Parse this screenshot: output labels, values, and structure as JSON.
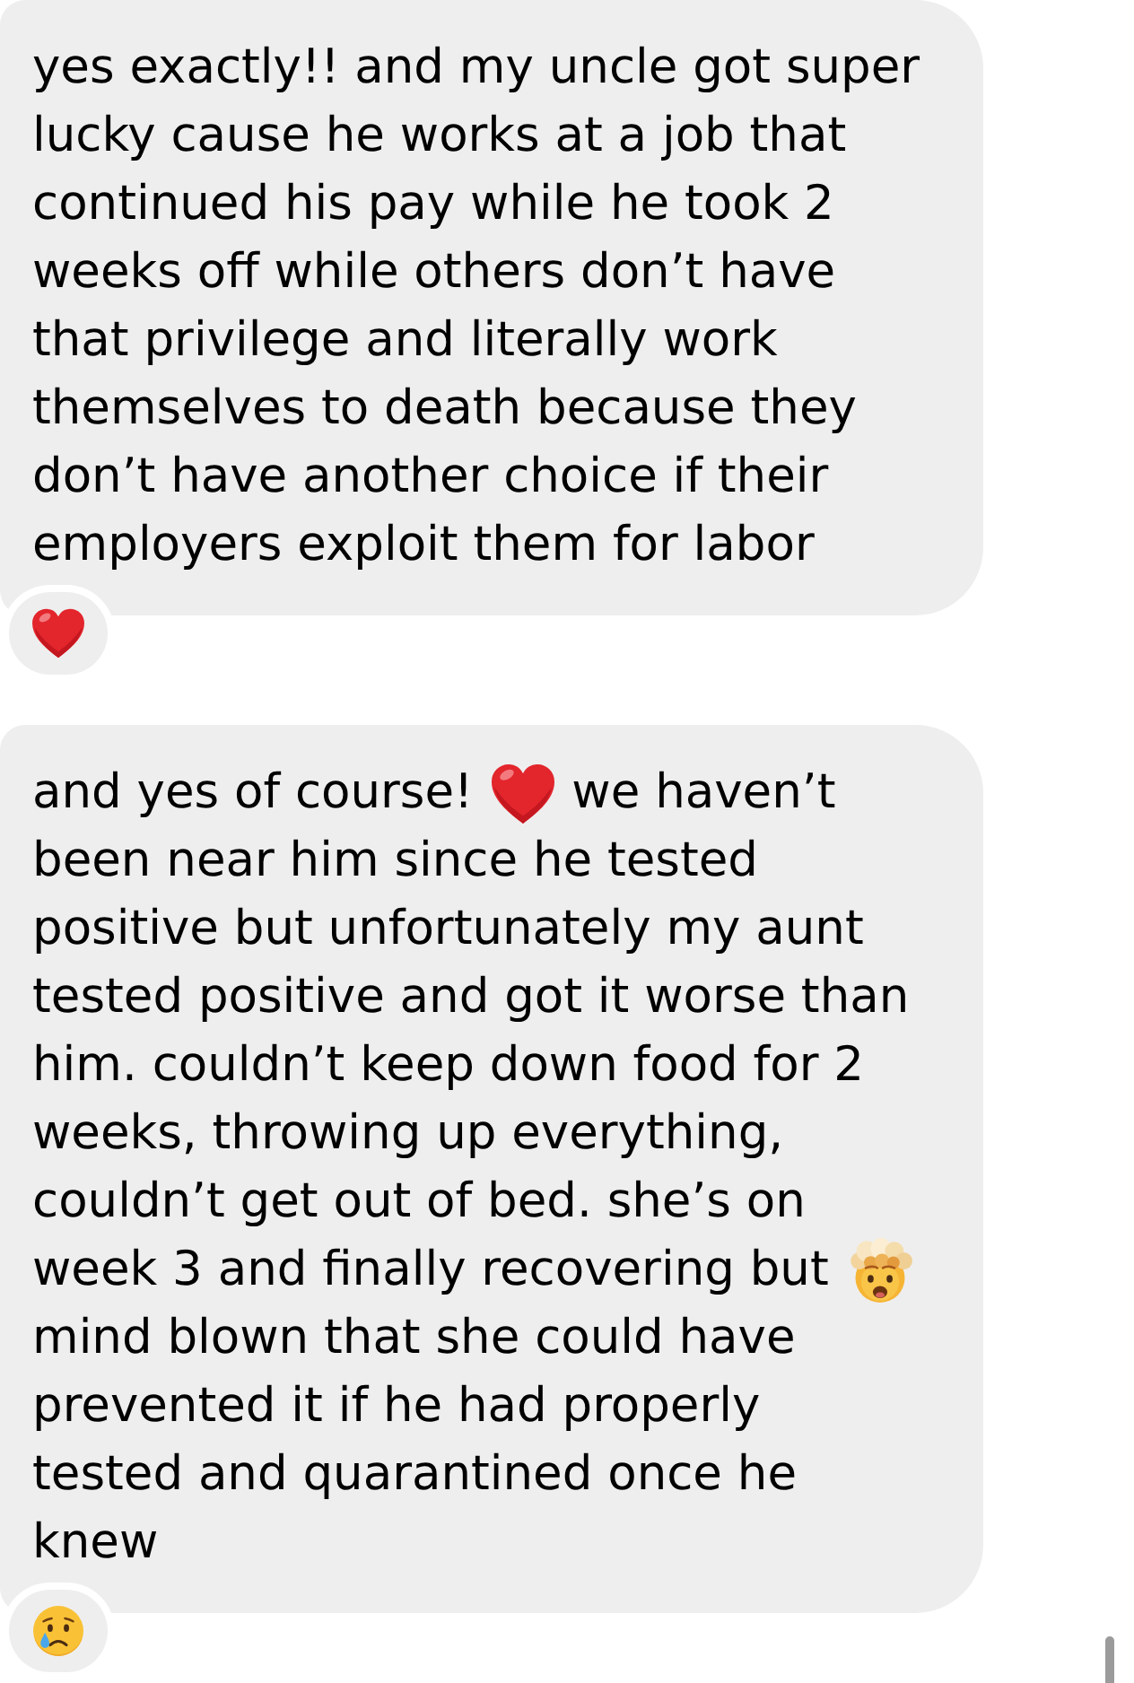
{
  "messages": [
    {
      "lines": [
        [
          {
            "kind": "text",
            "text": "yes exactly!! and my uncle got super"
          }
        ],
        [
          {
            "kind": "text",
            "text": "lucky cause he works at a job that"
          }
        ],
        [
          {
            "kind": "text",
            "text": "continued his pay while he took 2"
          }
        ],
        [
          {
            "kind": "text",
            "text": "weeks off while others don’t have"
          }
        ],
        [
          {
            "kind": "text",
            "text": "that privilege and literally work"
          }
        ],
        [
          {
            "kind": "text",
            "text": "themselves to death because they"
          }
        ],
        [
          {
            "kind": "text",
            "text": "don’t have another choice if their"
          }
        ],
        [
          {
            "kind": "text",
            "text": "employers exploit them for labor"
          }
        ]
      ],
      "reaction": {
        "kind": "heart"
      }
    },
    {
      "lines": [
        [
          {
            "kind": "text",
            "text": "and yes of course!"
          },
          {
            "kind": "heart"
          },
          {
            "kind": "text",
            "text": "we haven’t"
          }
        ],
        [
          {
            "kind": "text",
            "text": "been near him since he tested"
          }
        ],
        [
          {
            "kind": "text",
            "text": "positive but unfortunately my aunt"
          }
        ],
        [
          {
            "kind": "text",
            "text": "tested positive and got it worse than"
          }
        ],
        [
          {
            "kind": "text",
            "text": "him. couldn’t keep down food for 2"
          }
        ],
        [
          {
            "kind": "text",
            "text": "weeks, throwing up everything,"
          }
        ],
        [
          {
            "kind": "text",
            "text": "couldn’t get out of bed. she’s on"
          }
        ],
        [
          {
            "kind": "text",
            "text": "week 3 and finally recovering but"
          },
          {
            "kind": "mindblown"
          }
        ],
        [
          {
            "kind": "text",
            "text": "mind blown that she could have"
          }
        ],
        [
          {
            "kind": "text",
            "text": "prevented it if he had properly"
          }
        ],
        [
          {
            "kind": "text",
            "text": "tested and quarantined once he"
          }
        ],
        [
          {
            "kind": "text",
            "text": "knew"
          }
        ]
      ],
      "reaction": {
        "kind": "crying"
      }
    }
  ]
}
